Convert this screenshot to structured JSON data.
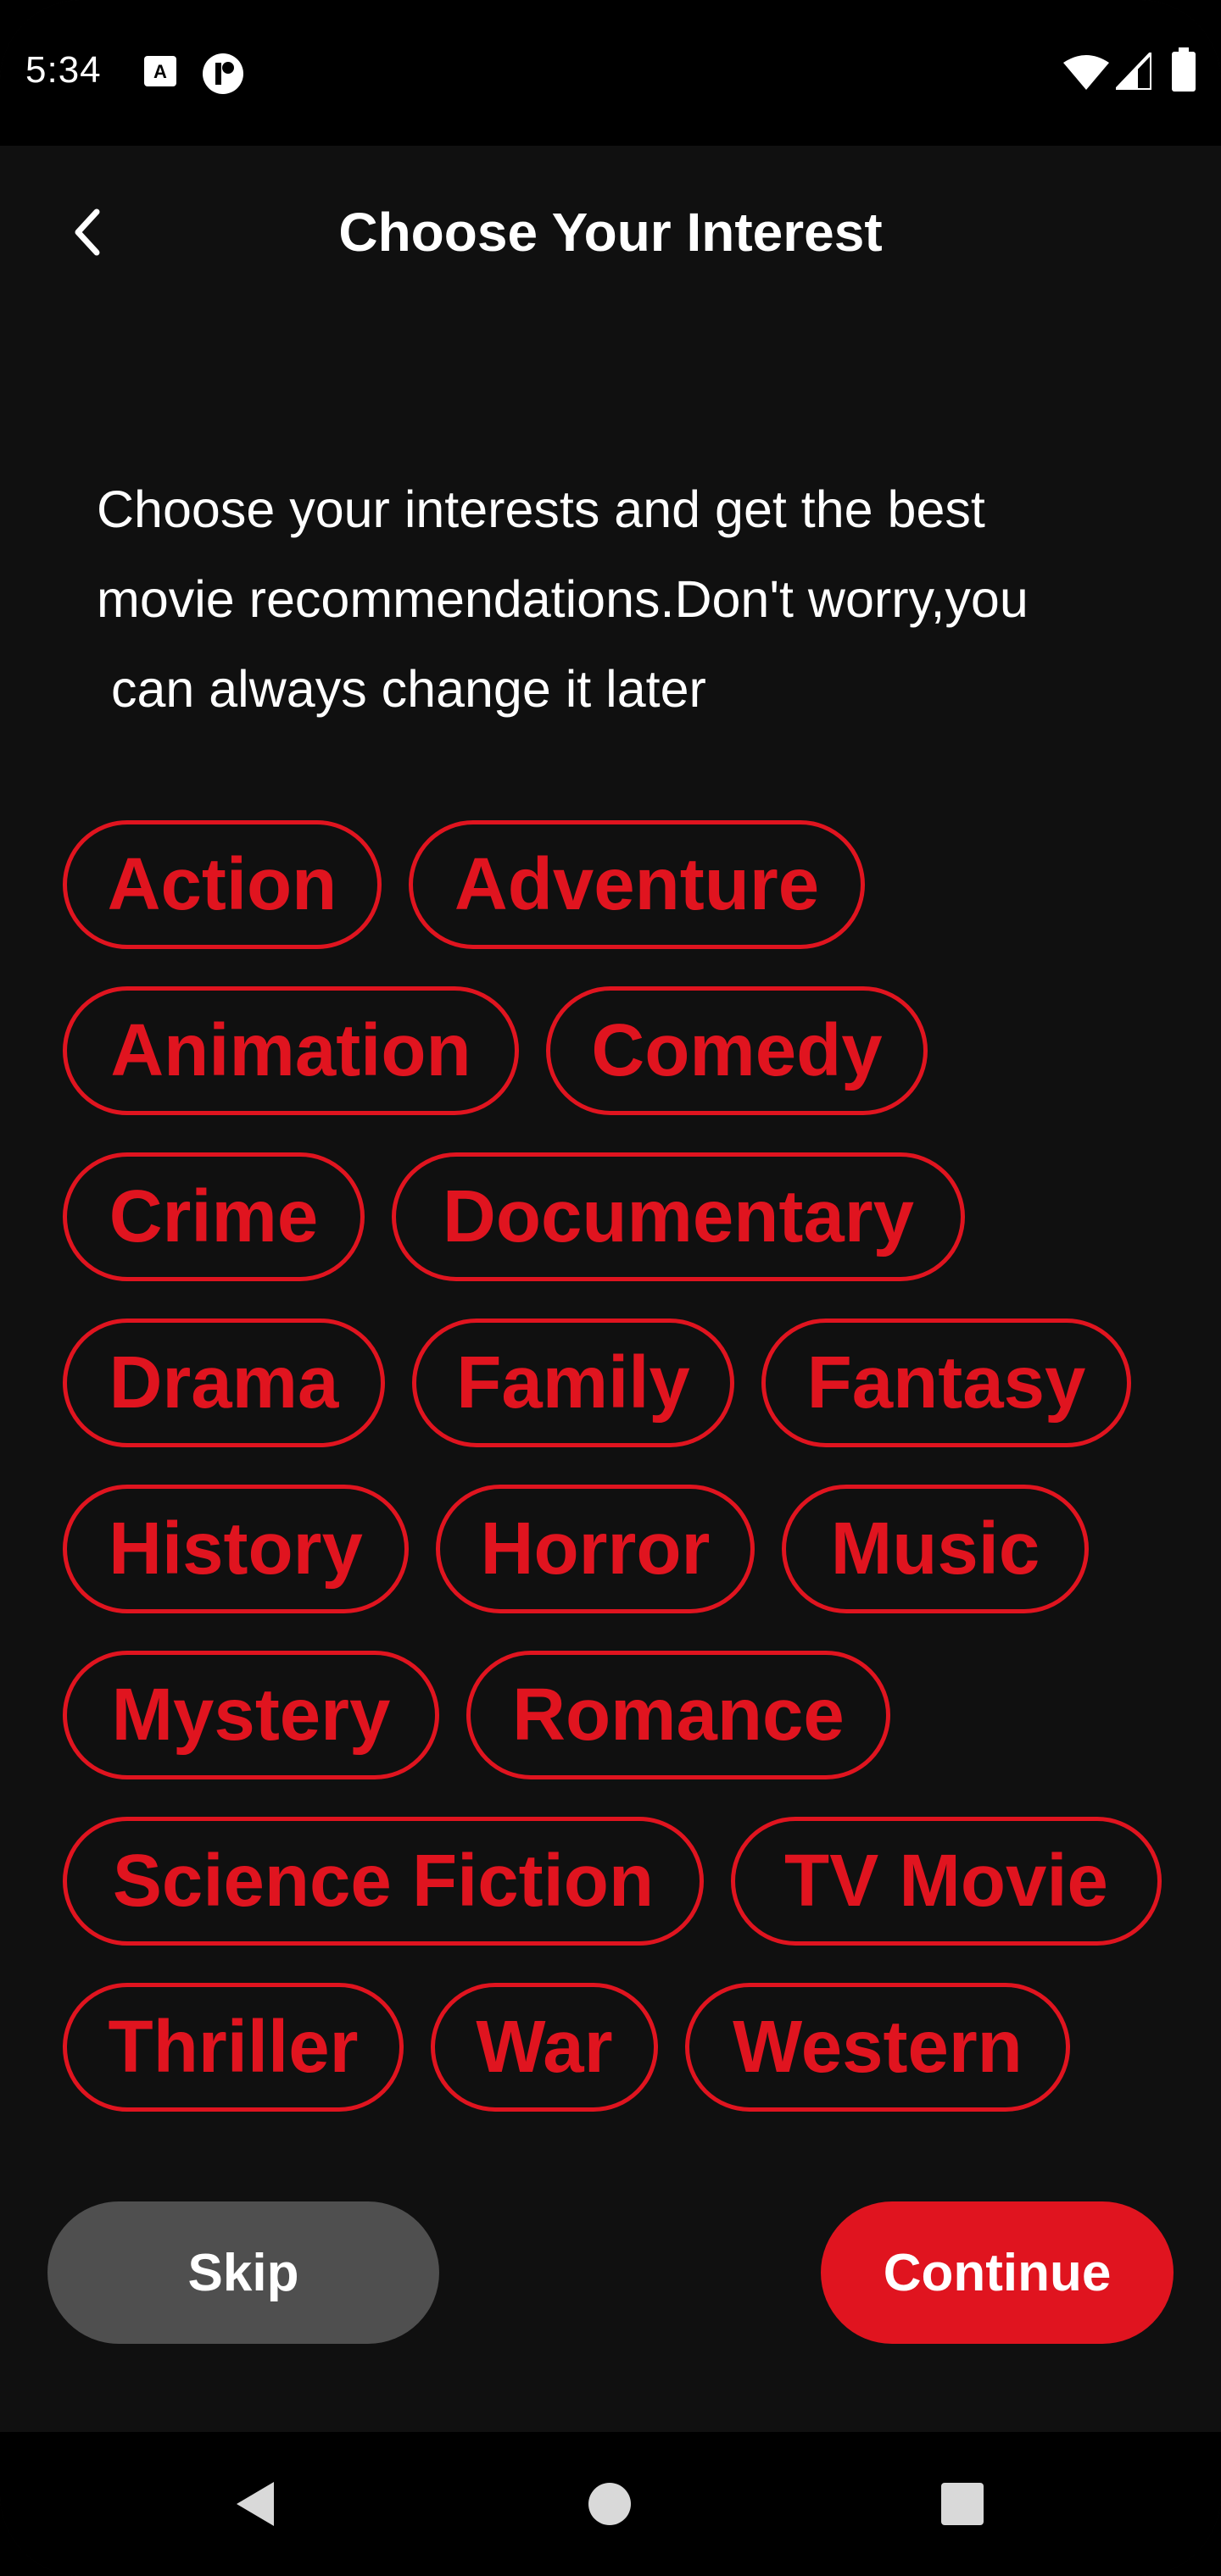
{
  "status_bar": {
    "time": "5:34",
    "icons": [
      "a-notification-icon",
      "t-notification-icon",
      "wifi-icon",
      "cell-signal-icon",
      "battery-icon"
    ]
  },
  "header": {
    "back_icon": "chevron-left-icon",
    "title": "Choose Your Interest"
  },
  "subtitle": "Choose your interests and get the best\nmovie recommendations.Don't worry,you\n can always change it later",
  "genres": [
    "Action",
    "Adventure",
    "Animation",
    "Comedy",
    "Crime",
    "Documentary",
    "Drama",
    "Family",
    "Fantasy",
    "History",
    "Horror",
    "Music",
    "Mystery",
    "Romance",
    "Science Fiction",
    "TV Movie",
    "Thriller",
    "War",
    "Western"
  ],
  "actions": {
    "skip_label": "Skip",
    "continue_label": "Continue"
  },
  "nav": {
    "icons": [
      "back-triangle-icon",
      "home-circle-icon",
      "recents-square-icon"
    ]
  },
  "colors": {
    "accent": "#e0141f",
    "background": "#101010",
    "skip_button": "#4f4f4f"
  }
}
